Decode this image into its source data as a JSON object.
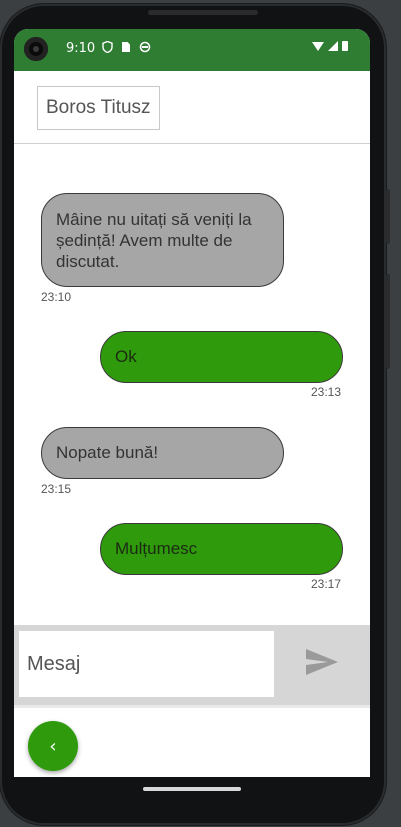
{
  "status_bar": {
    "time": "9:10",
    "left_icons": [
      "shield-icon",
      "sim-card-icon",
      "sync-icon"
    ],
    "right_icons": [
      "wifi-icon",
      "signal-icon",
      "battery-icon"
    ],
    "color": "#2e7d32"
  },
  "header": {
    "contact_name": "Boros Titusz"
  },
  "messages": [
    {
      "direction": "incoming",
      "text": "Mâine nu uitați să veniți la ședință! Avem multe de discutat.",
      "time": "23:10"
    },
    {
      "direction": "outgoing",
      "text": "Ok",
      "time": "23:13"
    },
    {
      "direction": "incoming",
      "text": "Nopate bună!",
      "time": "23:15"
    },
    {
      "direction": "outgoing",
      "text": "Mulțumesc",
      "time": "23:17"
    }
  ],
  "composer": {
    "placeholder": "Mesaj",
    "value": "",
    "send_icon": "send-icon"
  },
  "fab": {
    "icon": "chevron-left-icon",
    "glyph": "‹"
  },
  "colors": {
    "incoming_bubble": "#a6a6a6",
    "outgoing_bubble": "#2e9a0c",
    "accent": "#2e9a0c"
  }
}
